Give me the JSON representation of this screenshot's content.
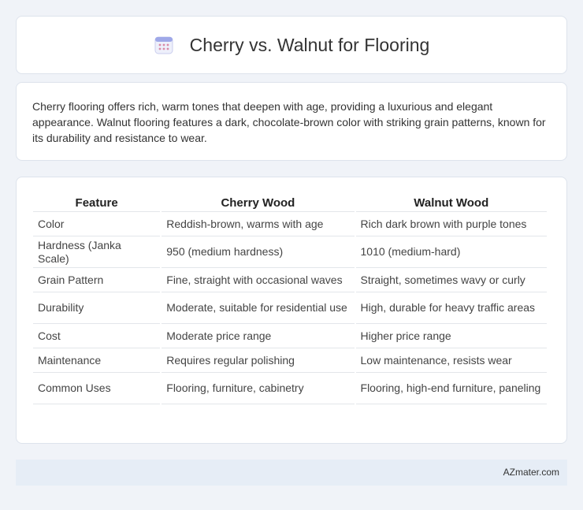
{
  "header": {
    "title": "Cherry vs. Walnut for Flooring",
    "icon": "calendar-icon"
  },
  "intro": {
    "text": "Cherry flooring offers rich, warm tones that deepen with age, providing a luxurious and elegant appearance. Walnut flooring features a dark, chocolate-brown color with striking grain patterns, known for its durability and resistance to wear."
  },
  "table": {
    "headers": [
      "Feature",
      "Cherry Wood",
      "Walnut Wood"
    ],
    "rows": [
      [
        "Color",
        "Reddish-brown, warms with age",
        "Rich dark brown with purple tones"
      ],
      [
        "Hardness (Janka Scale)",
        "950 (medium hardness)",
        "1010 (medium-hard)"
      ],
      [
        "Grain Pattern",
        "Fine, straight with occasional waves",
        "Straight, sometimes wavy or curly"
      ],
      [
        "Durability",
        "Moderate, suitable for residential use",
        "High, durable for heavy traffic areas"
      ],
      [
        "Cost",
        "Moderate price range",
        "Higher price range"
      ],
      [
        "Maintenance",
        "Requires regular polishing",
        "Low maintenance, resists wear"
      ],
      [
        "Common Uses",
        "Flooring, furniture, cabinetry",
        "Flooring, high-end furniture, paneling"
      ]
    ]
  },
  "footer": {
    "text": "AZmater.com"
  }
}
